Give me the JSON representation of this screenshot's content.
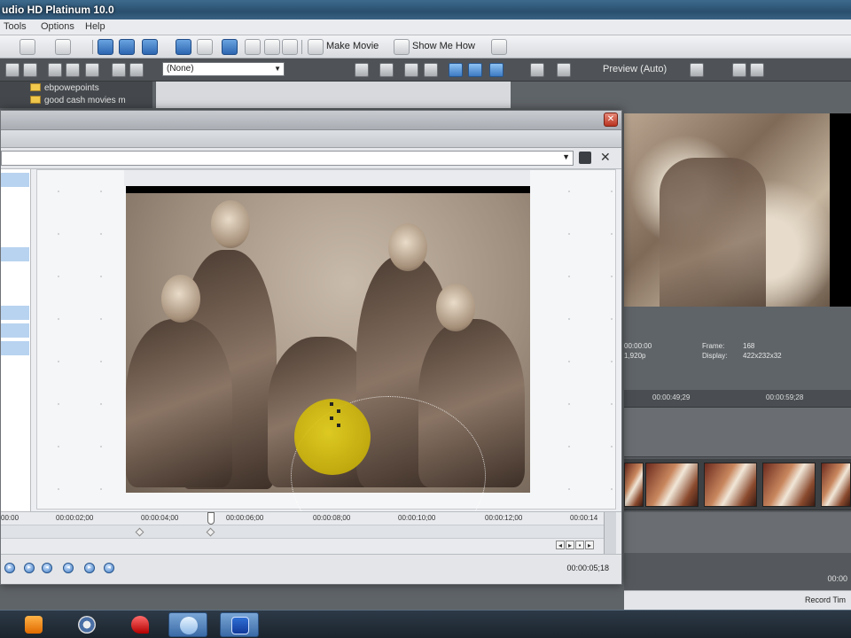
{
  "window": {
    "title": "udio HD Platinum 10.0"
  },
  "menu": [
    "Tools",
    "Options",
    "Help"
  ],
  "toolbar": {
    "make_movie": "Make Movie",
    "show_me_how": "Show Me How"
  },
  "effects_select": {
    "value": "(None)"
  },
  "explorer": {
    "items": [
      "ebpowepoints",
      "good cash movies m"
    ]
  },
  "preview": {
    "mode_label": "Preview (Auto)"
  },
  "preview_info": {
    "left_top": "00:00:00",
    "left_bottom": "1,920p",
    "frame_label": "Frame:",
    "frame_value": "168",
    "display_label": "Display:",
    "display_value": "422x232x32"
  },
  "timeline_right": {
    "ticks": [
      "00:00:49;29",
      "00:00:59;28"
    ],
    "timecode": "00:00",
    "record_time_label": "Record Tim"
  },
  "dialog": {
    "ruler_ticks": [
      "00:00",
      "00:00:02;00",
      "00:00:04;00",
      "00:00:06;00",
      "00:00:08;00",
      "00:00:10;00",
      "00:00:12;00",
      "00:00:14"
    ],
    "timecode": "00:00:05;18"
  },
  "colors": {
    "focus": "#e6d21d",
    "accent": "#3d7ac2",
    "titlebar": "#2a4f6e"
  },
  "icons": {
    "taskbar": [
      "media-player-icon",
      "chrome-icon",
      "pin-icon",
      "explorer-icon",
      "vegas-icon"
    ],
    "dialog_controls": [
      "play-icon",
      "next-keyframe-icon",
      "prev-keyframe-icon"
    ]
  }
}
